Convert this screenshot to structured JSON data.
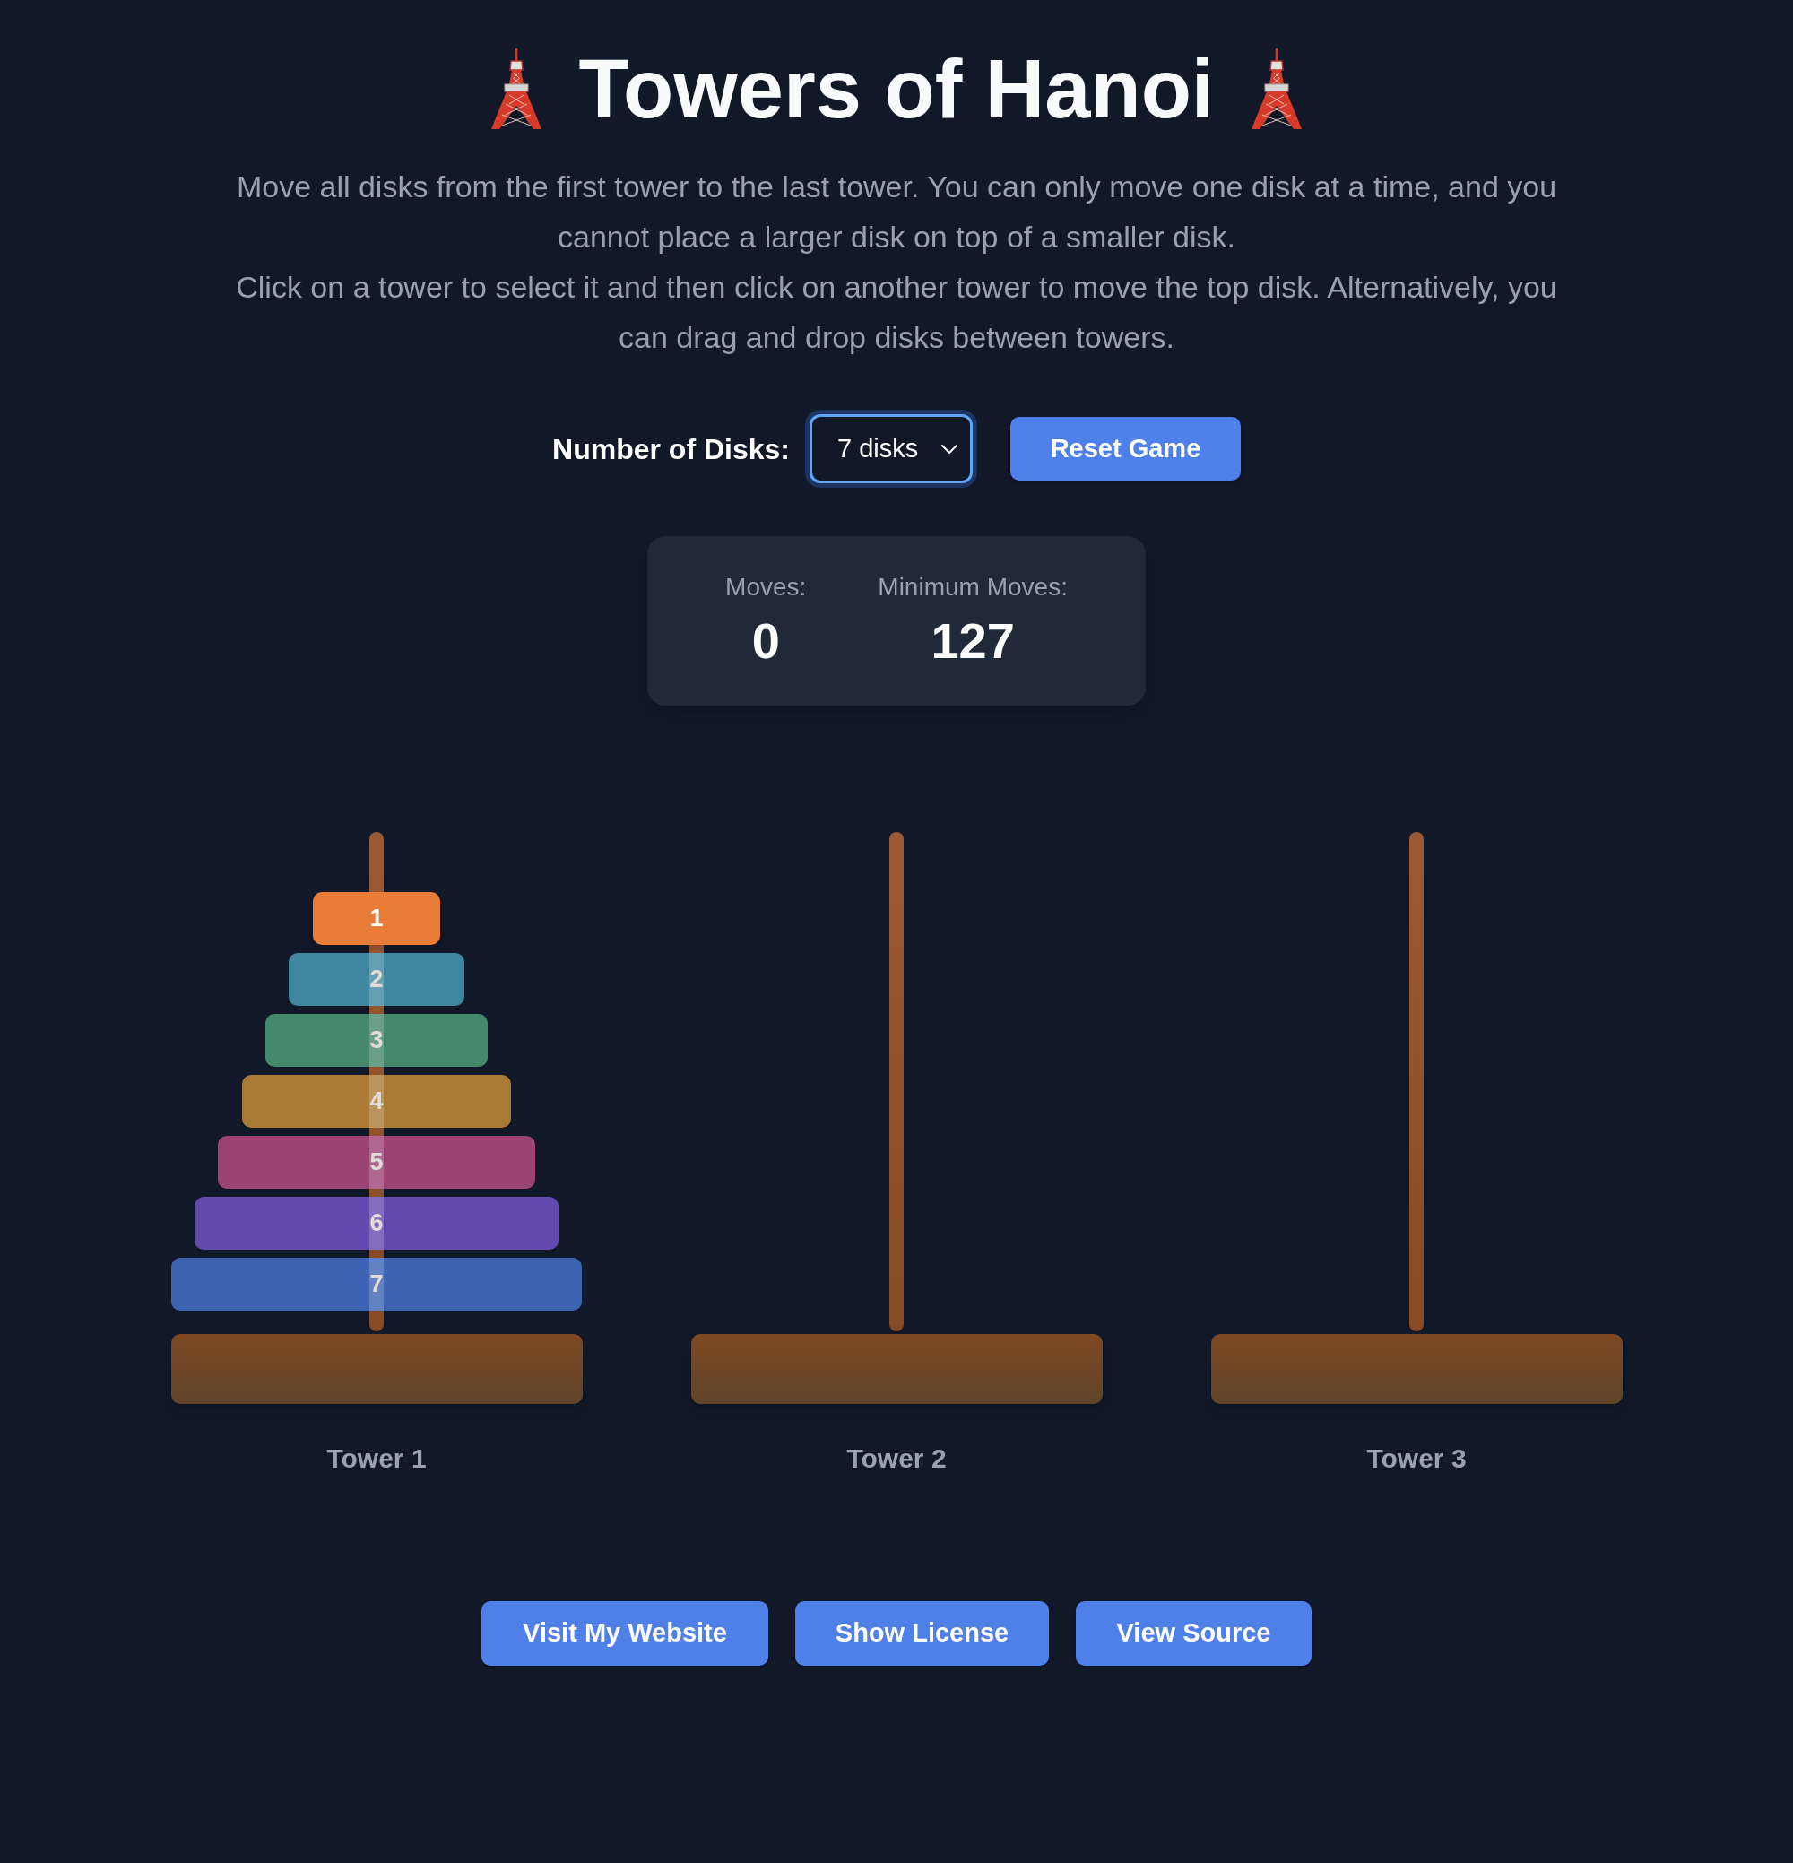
{
  "title": "Towers of Hanoi",
  "instructions": [
    "Move all disks from the first tower to the last tower. You can only move one disk at a time, and you cannot place a larger disk on top of a smaller disk.",
    "Click on a tower to select it and then click on another tower to move the top disk. Alternatively, you can drag and drop disks between towers."
  ],
  "controls": {
    "disk_count_label": "Number of Disks:",
    "disk_count_select": {
      "value": "7 disks"
    },
    "reset_button": "Reset Game"
  },
  "stats": [
    {
      "label": "Moves:",
      "value": "0"
    },
    {
      "label": "Minimum Moves:",
      "value": "127"
    }
  ],
  "towers": [
    {
      "label": "Tower 1",
      "selected": false,
      "disks": [
        {
          "label": "1",
          "color": "#e97c37",
          "movable": true
        },
        {
          "label": "2",
          "color": "#3f87a0",
          "movable": false
        },
        {
          "label": "3",
          "color": "#44896a",
          "movable": false
        },
        {
          "label": "4",
          "color": "#aa7b36",
          "movable": false
        },
        {
          "label": "5",
          "color": "#9c4373",
          "movable": false
        },
        {
          "label": "6",
          "color": "#634aaf",
          "movable": false
        },
        {
          "label": "7",
          "color": "#3d63b2",
          "movable": false
        }
      ]
    },
    {
      "label": "Tower 2",
      "selected": false
    },
    {
      "label": "Tower 3",
      "selected": false
    }
  ],
  "footer_buttons": [
    "Visit My Website",
    "Show License",
    "View Source"
  ]
}
